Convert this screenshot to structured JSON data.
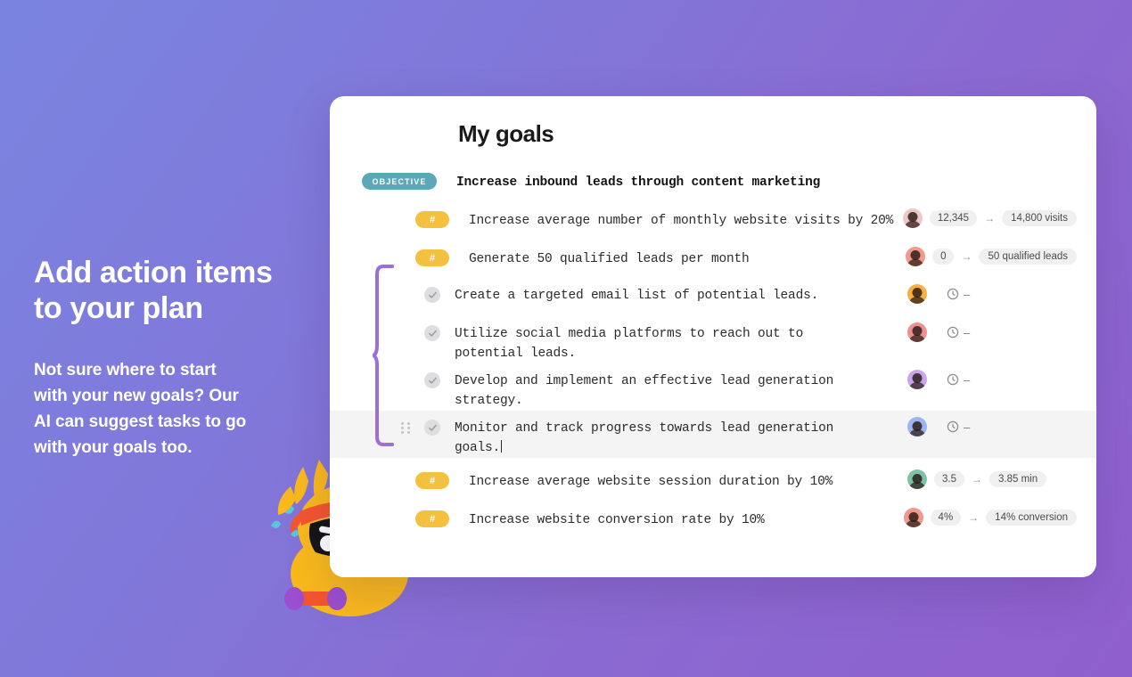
{
  "promo": {
    "headline": "Add action items\nto your plan",
    "body": "Not sure where to start\nwith your new goals? Our\nAI can suggest tasks to go\nwith your goals too."
  },
  "card": {
    "title": "My goals"
  },
  "colors": {
    "background_start": "#7a84e0",
    "background_end": "#8f5fcd",
    "objective_badge": "#5aa8b8",
    "key_result_badge": "#f4c13f",
    "brace": "#9b6fd6",
    "highlight_row": "#f4f4f5"
  },
  "objective": {
    "badge_label": "OBJECTIVE",
    "text": "Increase inbound leads through content marketing"
  },
  "goals": [
    {
      "badge_label": "#",
      "text": "Increase average number of monthly website visits by 20%",
      "metric_from": "12,345",
      "metric_arrow": "→",
      "metric_to": "14,800 visits",
      "avatar_color": "#f0c7c7"
    },
    {
      "badge_label": "#",
      "text": "Generate 50 qualified leads per month",
      "metric_from": "0",
      "metric_arrow": "→",
      "metric_to": "50 qualified leads",
      "avatar_color": "#ef9a8c"
    }
  ],
  "tasks": [
    {
      "text": "Create a targeted email list of potential leads.",
      "checked": true,
      "time_value": "–",
      "avatar_color": "#f5b041",
      "highlighted": false,
      "has_drag_handle": false
    },
    {
      "text": "Utilize social media platforms to reach out to\npotential leads.",
      "checked": true,
      "time_value": "–",
      "avatar_color": "#ef8f8f",
      "highlighted": false,
      "has_drag_handle": false
    },
    {
      "text": "Develop and implement an effective lead generation\nstrategy.",
      "checked": true,
      "time_value": "–",
      "avatar_color": "#c9a6ec",
      "highlighted": false,
      "has_drag_handle": false
    },
    {
      "text": "Monitor and track progress towards lead generation\ngoals.",
      "checked": true,
      "time_value": "–",
      "avatar_color": "#9fb5ef",
      "highlighted": true,
      "has_drag_handle": true
    }
  ],
  "goals_after": [
    {
      "badge_label": "#",
      "text": "Increase average website session duration by 10%",
      "metric_from": "3.5",
      "metric_arrow": "→",
      "metric_to": "3.85 min",
      "avatar_color": "#7ec2a8"
    },
    {
      "badge_label": "#",
      "text": "Increase website conversion rate by 10%",
      "metric_from": "4%",
      "metric_arrow": "→",
      "metric_to": "14% conversion",
      "avatar_color": "#f09a8e"
    }
  ],
  "mascot": {
    "name": "ninja-robot-mascot",
    "body_color": "#f9b91c",
    "headband_color": "#f4552f",
    "face_color": "#141414",
    "weight_color": "#9b4fd0",
    "sweat_color": "#5bc6d8"
  }
}
